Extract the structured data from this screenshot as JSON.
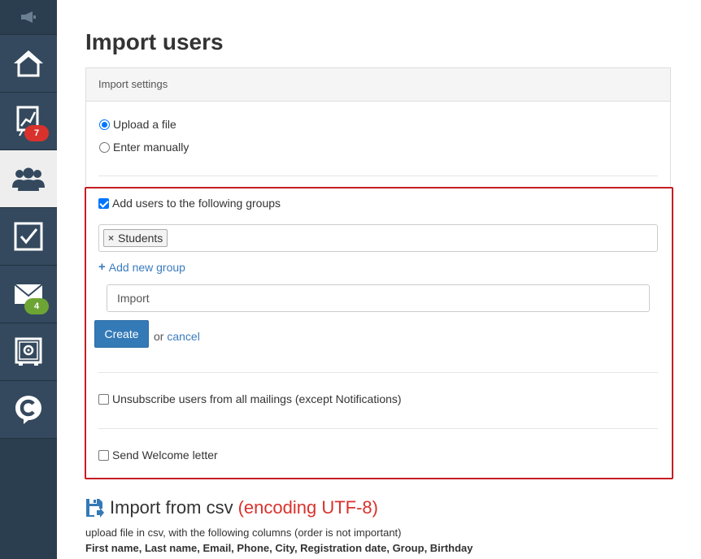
{
  "page": {
    "title": "Import users"
  },
  "sidebar": {
    "items": [
      {
        "name": "home",
        "icon": "home-icon"
      },
      {
        "name": "stats",
        "icon": "chart-board-icon",
        "badge": "7"
      },
      {
        "name": "users",
        "icon": "users-group-icon",
        "active": true
      },
      {
        "name": "tasks",
        "icon": "checkbox-icon"
      },
      {
        "name": "mail",
        "icon": "envelope-icon",
        "badge": "4"
      },
      {
        "name": "safe",
        "icon": "safe-icon"
      },
      {
        "name": "chat",
        "icon": "chat-c-icon"
      }
    ],
    "colors": {
      "bg": "#2b3e50",
      "badge_red": "#d9322c",
      "badge_green": "#6da534"
    }
  },
  "settings": {
    "header": "Import settings",
    "mode_options": [
      {
        "label": "Upload a file",
        "checked": true
      },
      {
        "label": "Enter manually",
        "checked": false
      }
    ]
  },
  "groups": {
    "add_checkbox_label": "Add users to the following groups",
    "add_checked": true,
    "tags": [
      "Students"
    ],
    "add_new_group_label": "Add new group",
    "new_group_value": "Import",
    "create_label": "Create",
    "or_text": "or",
    "cancel_label": "cancel",
    "unsubscribe_label": "Unsubscribe users from all mailings (except Notifications)",
    "unsubscribe_checked": false,
    "welcome_label": "Send Welcome letter",
    "welcome_checked": false
  },
  "csv": {
    "title": "Import from csv",
    "encoding": "(encoding UTF-8)",
    "description": "upload file in csv, with the following columns (order is not important)",
    "columns": "First name, Last name, Email, Phone, City, Registration date, Group, Birthday"
  },
  "colors": {
    "accent": "#337ab7",
    "link": "#3a7bbf",
    "highlight_border": "#c41e24"
  }
}
